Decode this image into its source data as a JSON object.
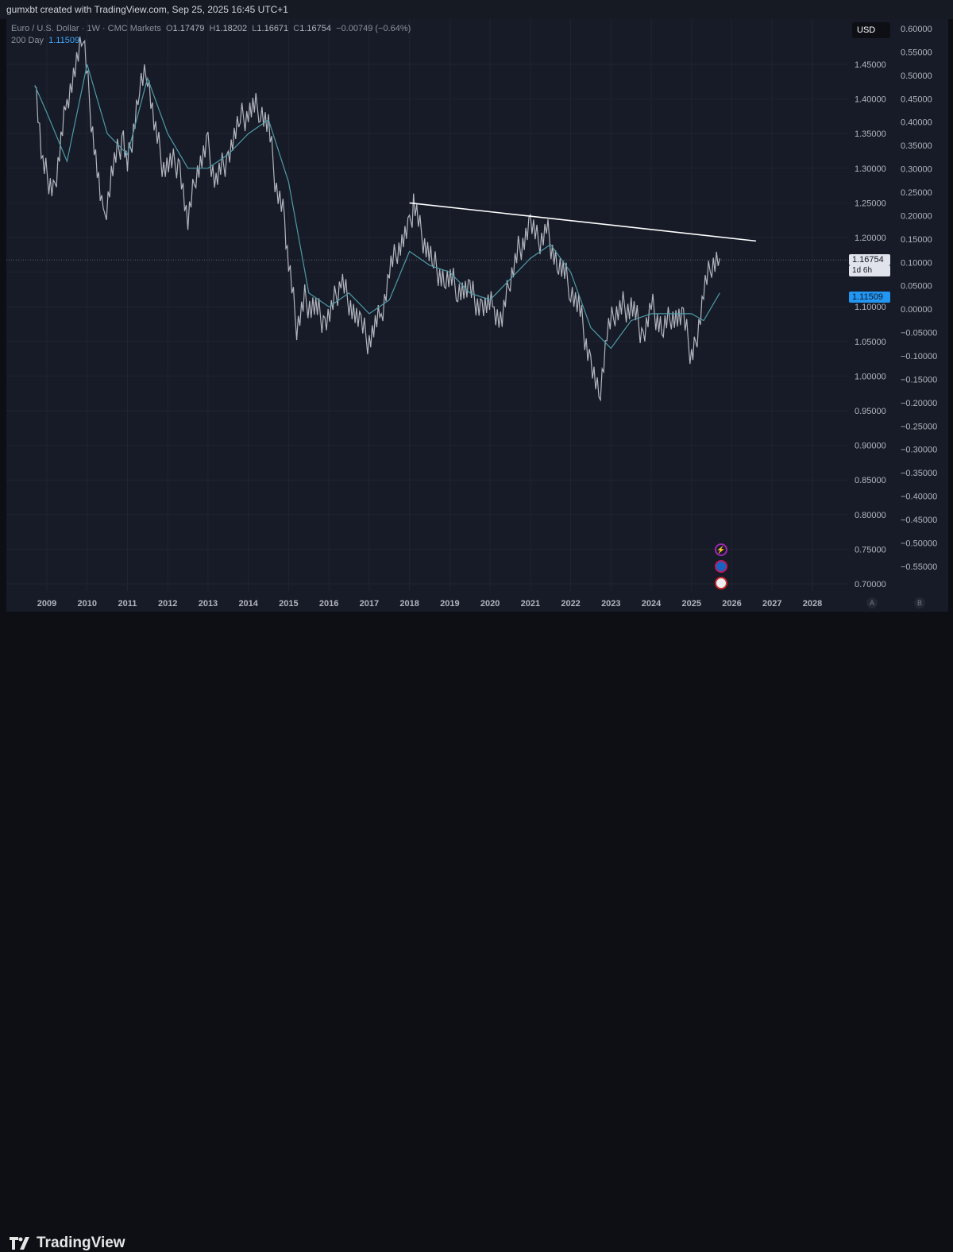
{
  "attribution": "gumxbt created with TradingView.com, Sep 25, 2025 16:45 UTC+1",
  "symbol_line": {
    "name": "Euro / U.S. Dollar · 1W · CMC Markets",
    "o_label": "O",
    "o": "1.17479",
    "h_label": "H",
    "h": "1.18202",
    "l_label": "L",
    "l": "1.16671",
    "c_label": "C",
    "c": "1.16754",
    "change": "−0.00749 (−0.64%)"
  },
  "indicator": {
    "name": "200 Day",
    "value": "1.11509",
    "color": "#42a5f5"
  },
  "currency_button": "USD",
  "price_tags": {
    "current": "1.16754",
    "countdown": "1d 6h",
    "ma": "1.11509"
  },
  "scale_buttons": [
    "A",
    "B"
  ],
  "brand": "TradingView",
  "events": [
    "lightning-event-icon",
    "globe-event-icon",
    "flag-us-event-icon"
  ],
  "chart_data": {
    "type": "line",
    "title": "Euro / U.S. Dollar · 1W · CMC Markets",
    "xlabel": "",
    "ylabel": "",
    "x_ticks": [
      "2009",
      "2010",
      "2011",
      "2012",
      "2013",
      "2014",
      "2015",
      "2016",
      "2017",
      "2018",
      "2019",
      "2020",
      "2021",
      "2022",
      "2023",
      "2024",
      "2025",
      "2026",
      "2027",
      "2028"
    ],
    "y_ticks": [
      "1.45000",
      "1.40000",
      "1.35000",
      "1.30000",
      "1.25000",
      "1.20000",
      "1.15000",
      "1.10000",
      "1.05000",
      "1.00000",
      "0.95000",
      "0.90000",
      "0.85000",
      "0.80000",
      "0.75000",
      "0.70000"
    ],
    "pct_ticks": [
      "0.60000",
      "0.55000",
      "0.50000",
      "0.45000",
      "0.40000",
      "0.35000",
      "0.30000",
      "0.25000",
      "0.20000",
      "0.15000",
      "0.10000",
      "0.05000",
      "0.00000",
      "−0.05000",
      "−0.10000",
      "−0.15000",
      "−0.20000",
      "−0.25000",
      "−0.30000",
      "−0.35000",
      "−0.40000",
      "−0.45000",
      "−0.50000",
      "−0.55000"
    ],
    "ylim": [
      0.69,
      1.49
    ],
    "xlim": [
      2008.7,
      2028.4
    ],
    "grid": true,
    "colors": {
      "price": "#b2b5be",
      "ma": "#4f9aa8",
      "trendline": "#ffffff",
      "background": "#161b27"
    },
    "series": [
      {
        "name": "Euro / U.S. Dollar",
        "x": [
          2008.7,
          2008.9,
          2009.2,
          2009.5,
          2009.9,
          2010.1,
          2010.4,
          2010.6,
          2010.9,
          2011.0,
          2011.3,
          2011.5,
          2011.7,
          2011.9,
          2012.3,
          2012.5,
          2012.7,
          2013.0,
          2013.2,
          2013.5,
          2013.8,
          2014.0,
          2014.3,
          2014.5,
          2014.7,
          2014.9,
          2015.0,
          2015.2,
          2015.4,
          2015.6,
          2015.9,
          2016.1,
          2016.3,
          2016.5,
          2016.8,
          2017.0,
          2017.3,
          2017.5,
          2017.7,
          2018.0,
          2018.1,
          2018.3,
          2018.6,
          2018.9,
          2019.2,
          2019.5,
          2019.8,
          2020.1,
          2020.3,
          2020.5,
          2020.7,
          2021.0,
          2021.2,
          2021.4,
          2021.7,
          2022.0,
          2022.2,
          2022.5,
          2022.7,
          2022.9,
          2023.1,
          2023.3,
          2023.5,
          2023.8,
          2024.0,
          2024.3,
          2024.5,
          2024.8,
          2025.0,
          2025.1,
          2025.3,
          2025.5,
          2025.7
        ],
        "y": [
          1.44,
          1.3,
          1.27,
          1.4,
          1.49,
          1.37,
          1.22,
          1.29,
          1.35,
          1.3,
          1.42,
          1.44,
          1.35,
          1.3,
          1.31,
          1.22,
          1.29,
          1.33,
          1.28,
          1.32,
          1.37,
          1.38,
          1.39,
          1.36,
          1.27,
          1.23,
          1.16,
          1.07,
          1.11,
          1.1,
          1.08,
          1.1,
          1.14,
          1.11,
          1.07,
          1.05,
          1.09,
          1.15,
          1.18,
          1.21,
          1.25,
          1.2,
          1.16,
          1.14,
          1.13,
          1.12,
          1.1,
          1.1,
          1.08,
          1.14,
          1.18,
          1.22,
          1.19,
          1.21,
          1.16,
          1.13,
          1.1,
          1.02,
          0.97,
          1.06,
          1.09,
          1.1,
          1.1,
          1.06,
          1.1,
          1.07,
          1.09,
          1.08,
          1.03,
          1.05,
          1.12,
          1.16,
          1.17
        ]
      },
      {
        "name": "200 Day",
        "x": [
          2008.7,
          2009.0,
          2009.5,
          2010.0,
          2010.5,
          2011.0,
          2011.5,
          2012.0,
          2012.5,
          2013.0,
          2013.5,
          2014.0,
          2014.5,
          2015.0,
          2015.5,
          2016.0,
          2016.5,
          2017.0,
          2017.5,
          2018.0,
          2018.5,
          2019.0,
          2019.5,
          2020.0,
          2020.5,
          2021.0,
          2021.5,
          2022.0,
          2022.5,
          2023.0,
          2023.5,
          2024.0,
          2024.5,
          2025.0,
          2025.3,
          2025.7
        ],
        "y": [
          1.42,
          1.38,
          1.31,
          1.45,
          1.35,
          1.32,
          1.43,
          1.35,
          1.3,
          1.3,
          1.32,
          1.35,
          1.37,
          1.28,
          1.12,
          1.1,
          1.12,
          1.09,
          1.11,
          1.18,
          1.16,
          1.15,
          1.12,
          1.11,
          1.14,
          1.17,
          1.19,
          1.15,
          1.07,
          1.04,
          1.08,
          1.09,
          1.09,
          1.09,
          1.08,
          1.12
        ]
      }
    ],
    "trendline": {
      "x": [
        2018.0,
        2026.6
      ],
      "y": [
        1.25,
        1.195
      ]
    },
    "last_price_line": 1.16754
  }
}
